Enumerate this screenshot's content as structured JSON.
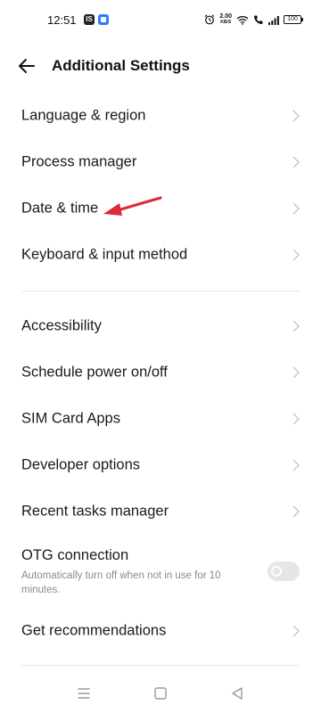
{
  "status": {
    "time": "12:51",
    "net_speed_value": "2.00",
    "net_speed_unit": "KB/S",
    "battery": "100",
    "icons": [
      "alarm-icon",
      "wifi-icon",
      "call-icon",
      "signal-icon",
      "battery-icon"
    ]
  },
  "header": {
    "title": "Additional Settings"
  },
  "group1": [
    {
      "label": "Language & region"
    },
    {
      "label": "Process manager"
    },
    {
      "label": "Date & time"
    },
    {
      "label": "Keyboard & input method"
    }
  ],
  "group2": [
    {
      "label": "Accessibility"
    },
    {
      "label": "Schedule power on/off"
    },
    {
      "label": "SIM Card Apps"
    },
    {
      "label": "Developer options"
    },
    {
      "label": "Recent tasks manager"
    }
  ],
  "otg": {
    "title": "OTG connection",
    "subtitle": "Automatically turn off when not in use for 10 minutes.",
    "enabled": false
  },
  "recommendations": {
    "label": "Get recommendations"
  },
  "colors": {
    "annotation_arrow": "#e0283c",
    "divider": "#e8e8e8",
    "toggle_off": "#e6e6e6"
  }
}
